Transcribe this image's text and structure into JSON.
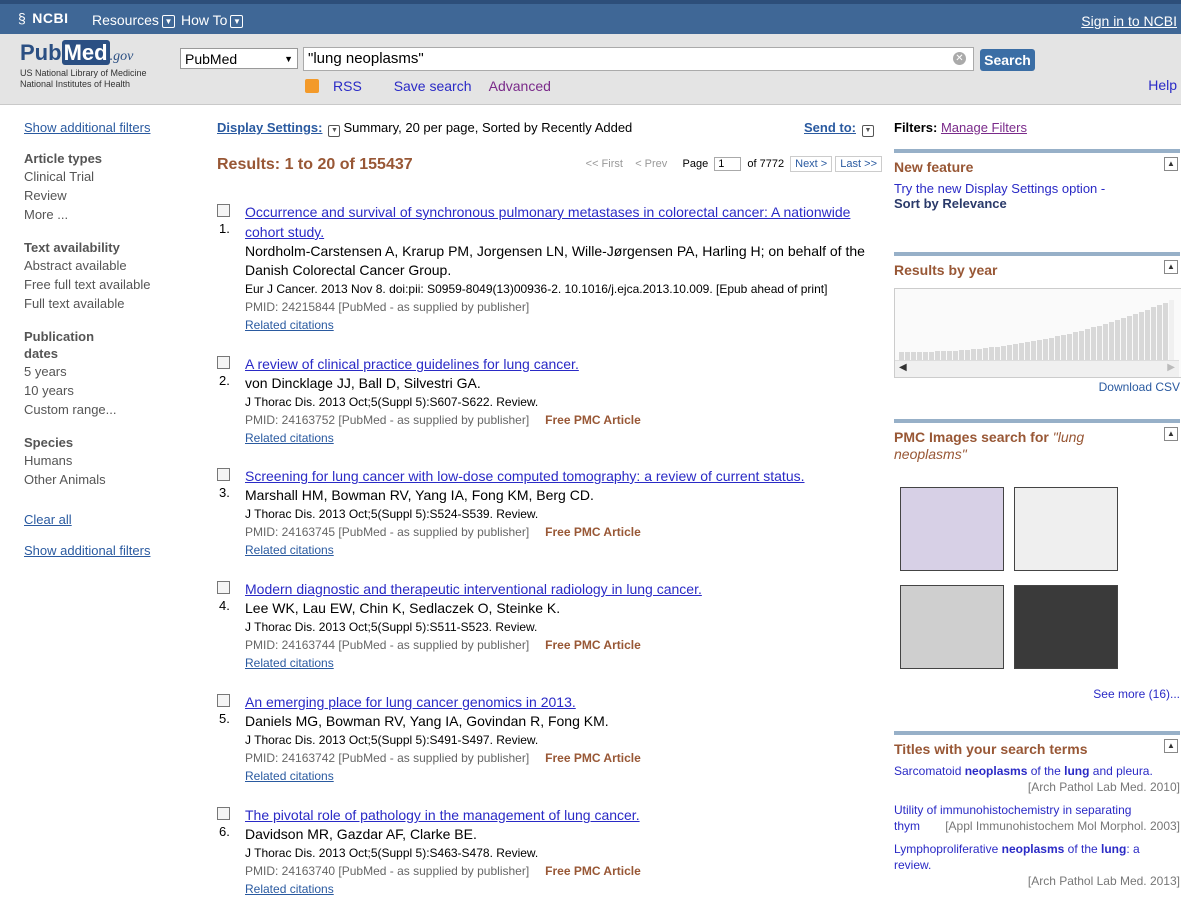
{
  "topbar": {
    "ncbi": "NCBI",
    "resources": "Resources",
    "howto": "How To",
    "signin": "Sign in to NCBI"
  },
  "logo": {
    "pub": "Pub",
    "med": "Med",
    "gov": ".gov",
    "line1": "US National Library of Medicine",
    "line2": "National Institutes of Health"
  },
  "search": {
    "db": "PubMed",
    "query": "\"lung neoplasms\"",
    "button": "Search",
    "rss": "RSS",
    "save": "Save search",
    "advanced": "Advanced",
    "help": "Help"
  },
  "left": {
    "show_filters": "Show additional filters",
    "groups": [
      {
        "head": "Article types",
        "items": [
          "Clinical Trial",
          "Review",
          "More ..."
        ]
      },
      {
        "head": "Text availability",
        "items": [
          "Abstract available",
          "Free full text available",
          "Full text available"
        ]
      },
      {
        "head": "Publication dates",
        "items": [
          "5 years",
          "10 years",
          "Custom range..."
        ]
      },
      {
        "head": "Species",
        "items": [
          "Humans",
          "Other Animals"
        ]
      }
    ],
    "clear_all": "Clear all",
    "show_filters_2": "Show additional filters"
  },
  "display": {
    "label": "Display Settings:",
    "value": "Summary, 20 per page, Sorted by Recently Added",
    "sendto": "Send to:"
  },
  "results": {
    "summary": "Results: 1 to 20 of 155437",
    "pager": {
      "first": "<< First",
      "prev": "< Prev",
      "page_label": "Page",
      "page": "1",
      "of": "of 7772",
      "next": "Next >",
      "last": "Last >>"
    },
    "items": [
      {
        "num": "1.",
        "title": "Occurrence and survival of synchronous pulmonary metastases in colorectal cancer: A nationwide cohort study.",
        "authors": "Nordholm-Carstensen A, Krarup PM, Jorgensen LN, Wille-Jørgensen PA, Harling H; on behalf of the Danish Colorectal Cancer Group.",
        "cite": "Eur J Cancer. 2013 Nov 8. doi:pii: S0959-8049(13)00936-2. 10.1016/j.ejca.2013.10.009. [Epub ahead of print]",
        "pmid": "PMID: 24215844 [PubMed - as supplied by publisher]",
        "free": "",
        "related": "Related citations"
      },
      {
        "num": "2.",
        "title": "A review of clinical practice guidelines for lung cancer.",
        "authors": "von Dincklage JJ, Ball D, Silvestri GA.",
        "cite": "J Thorac Dis. 2013 Oct;5(Suppl 5):S607-S622. Review.",
        "pmid": "PMID: 24163752 [PubMed - as supplied by publisher]",
        "free": "Free PMC Article",
        "related": "Related citations"
      },
      {
        "num": "3.",
        "title": "Screening for lung cancer with low-dose computed tomography: a review of current status.",
        "authors": "Marshall HM, Bowman RV, Yang IA, Fong KM, Berg CD.",
        "cite": "J Thorac Dis. 2013 Oct;5(Suppl 5):S524-S539. Review.",
        "pmid": "PMID: 24163745 [PubMed - as supplied by publisher]",
        "free": "Free PMC Article",
        "related": "Related citations"
      },
      {
        "num": "4.",
        "title": "Modern diagnostic and therapeutic interventional radiology in lung cancer.",
        "authors": "Lee WK, Lau EW, Chin K, Sedlaczek O, Steinke K.",
        "cite": "J Thorac Dis. 2013 Oct;5(Suppl 5):S511-S523. Review.",
        "pmid": "PMID: 24163744 [PubMed - as supplied by publisher]",
        "free": "Free PMC Article",
        "related": "Related citations"
      },
      {
        "num": "5.",
        "title": "An emerging place for lung cancer genomics in 2013.",
        "authors": "Daniels MG, Bowman RV, Yang IA, Govindan R, Fong KM.",
        "cite": "J Thorac Dis. 2013 Oct;5(Suppl 5):S491-S497. Review.",
        "pmid": "PMID: 24163742 [PubMed - as supplied by publisher]",
        "free": "Free PMC Article",
        "related": "Related citations"
      },
      {
        "num": "6.",
        "title": "The pivotal role of pathology in the management of lung cancer.",
        "authors": "Davidson MR, Gazdar AF, Clarke BE.",
        "cite": "J Thorac Dis. 2013 Oct;5(Suppl 5):S463-S478. Review.",
        "pmid": "PMID: 24163740 [PubMed - as supplied by publisher]",
        "free": "Free PMC Article",
        "related": "Related citations"
      }
    ]
  },
  "right": {
    "filters_label": "Filters:",
    "manage": "Manage Filters",
    "newfeature": {
      "title": "New feature",
      "text": "Try the new Display Settings option -",
      "bold": "Sort by Relevance"
    },
    "byyear": {
      "title": "Results by year",
      "download": "Download CSV"
    },
    "pmc": {
      "title": "PMC Images search for ",
      "query": "\"lung neoplasms\"",
      "seemore": "See more (16)..."
    },
    "titles": {
      "title": "Titles with your search terms",
      "items": [
        {
          "pre": "Sarcomatoid ",
          "b1": "neoplasms",
          "mid": " of the ",
          "b2": "lung",
          "post": " and pleura.",
          "src": "[Arch Pathol Lab Med. 2010]"
        },
        {
          "pre": "Utility of immunohistochemistry in separating thym",
          "b1": "",
          "mid": "",
          "b2": "",
          "post": "",
          "src": "[Appl Immunohistochem Mol Morphol. 2003]"
        },
        {
          "pre": "Lymphoproliferative ",
          "b1": "neoplasms",
          "mid": " of the ",
          "b2": "lung",
          "post": ": a review.",
          "src": "[Arch Pathol Lab Med. 2013]"
        }
      ]
    }
  }
}
